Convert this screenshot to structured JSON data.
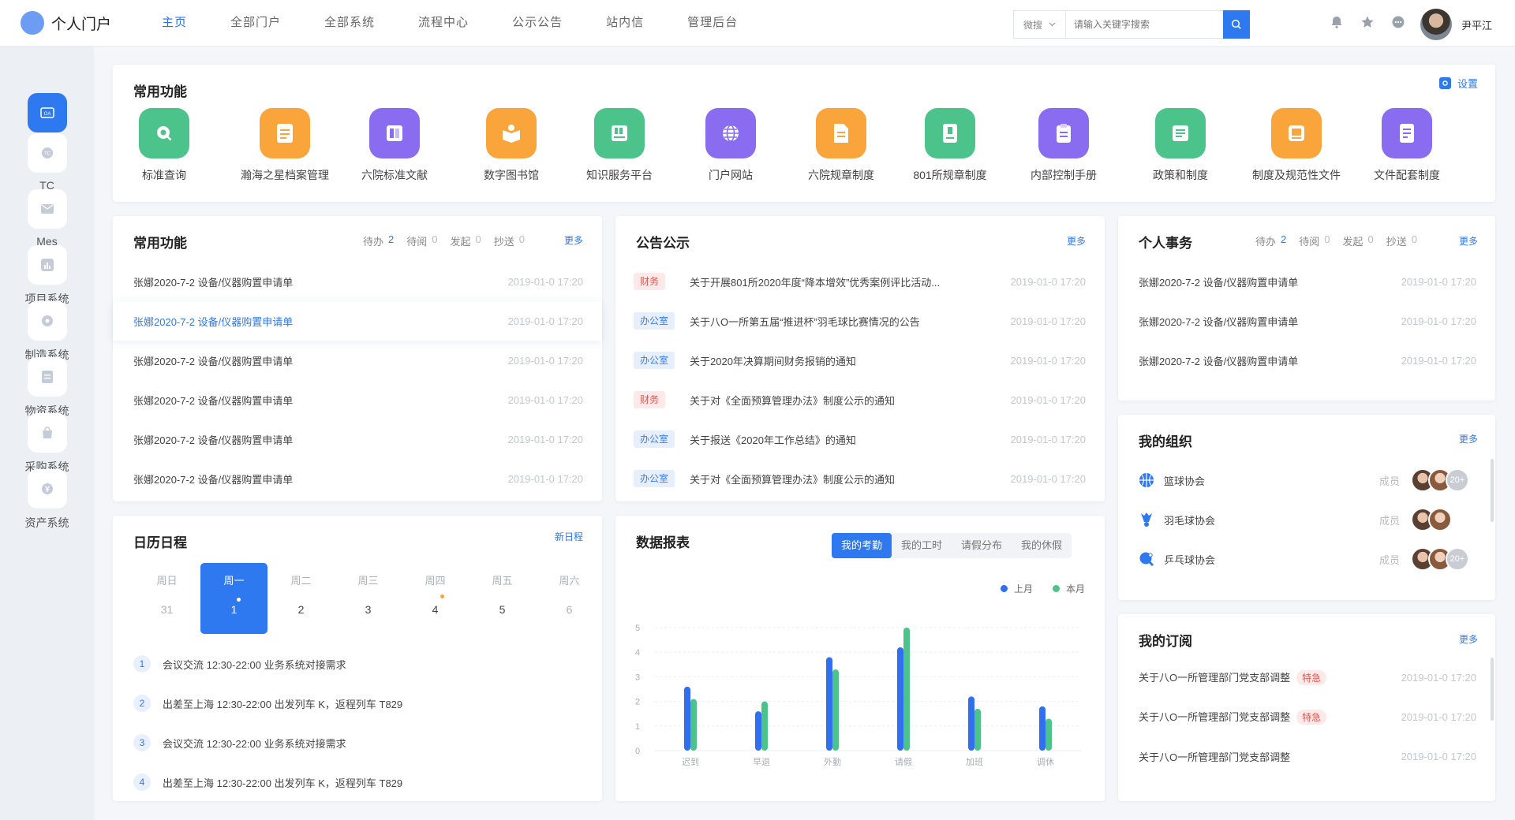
{
  "header": {
    "brand": "个人门户",
    "nav": [
      "主页",
      "全部门户",
      "全部系统",
      "流程中心",
      "公示公告",
      "站内信",
      "管理后台"
    ],
    "search": {
      "scope": "微搜",
      "placeholder": "请输入关键字搜索"
    },
    "user_name": "尹平江"
  },
  "sidebar": [
    "OA系统",
    "TC",
    "Mes",
    "项目系统",
    "制造系统",
    "物资系统",
    "采购系统",
    "资产系统"
  ],
  "quick": {
    "title": "常用功能",
    "settings": "设置",
    "tools": [
      "标准查询",
      "瀚海之星档案管理",
      "六院标准文献",
      "数字图书馆",
      "知识服务平台",
      "门户网站",
      "六院规章制度",
      "801所规章制度",
      "内部控制手册",
      "政策和制度",
      "制度及规范性文件",
      "文件配套制度"
    ]
  },
  "common": {
    "title": "常用功能",
    "stats": [
      {
        "label": "待办",
        "value": "2"
      },
      {
        "label": "待阅",
        "value": "0"
      },
      {
        "label": "发起",
        "value": "0"
      },
      {
        "label": "抄送",
        "value": "0"
      }
    ],
    "more": "更多",
    "rows": [
      {
        "text": "张娜2020-7-2 设备/仪器购置申请单",
        "time": "2019-01-0 17:20"
      },
      {
        "text": "张娜2020-7-2 设备/仪器购置申请单",
        "time": "2019-01-0 17:20"
      },
      {
        "text": "张娜2020-7-2 设备/仪器购置申请单",
        "time": "2019-01-0 17:20"
      },
      {
        "text": "张娜2020-7-2 设备/仪器购置申请单",
        "time": "2019-01-0 17:20"
      },
      {
        "text": "张娜2020-7-2 设备/仪器购置申请单",
        "time": "2019-01-0 17:20"
      },
      {
        "text": "张娜2020-7-2 设备/仪器购置申请单",
        "time": "2019-01-0 17:20"
      }
    ]
  },
  "notice": {
    "title": "公告公示",
    "more": "更多",
    "rows": [
      {
        "tag": "财务",
        "text": "关于开展801所2020年度“降本增效”优秀案例评比活动...",
        "time": "2019-01-0 17:20"
      },
      {
        "tag": "办公室",
        "text": "关于八O一所第五届“推进杯”羽毛球比赛情况的公告",
        "time": "2019-01-0 17:20"
      },
      {
        "tag": "办公室",
        "text": "关于2020年决算期间财务报销的通知",
        "time": "2019-01-0 17:20"
      },
      {
        "tag": "财务",
        "text": "关于对《全面预算管理办法》制度公示的通知",
        "time": "2019-01-0 17:20"
      },
      {
        "tag": "办公室",
        "text": "关于报送《2020年工作总结》的通知",
        "time": "2019-01-0 17:20"
      },
      {
        "tag": "办公室",
        "text": "关于对《全面预算管理办法》制度公示的通知",
        "time": "2019-01-0 17:20"
      }
    ]
  },
  "personal": {
    "title": "个人事务",
    "stats": [
      {
        "label": "待办",
        "value": "2"
      },
      {
        "label": "待阅",
        "value": "0"
      },
      {
        "label": "发起",
        "value": "0"
      },
      {
        "label": "抄送",
        "value": "0"
      }
    ],
    "more": "更多",
    "rows": [
      {
        "text": "张娜2020-7-2 设备/仪器购置申请单",
        "time": "2019-01-0 17:20"
      },
      {
        "text": "张娜2020-7-2 设备/仪器购置申请单",
        "time": "2019-01-0 17:20"
      },
      {
        "text": "张娜2020-7-2 设备/仪器购置申请单",
        "time": "2019-01-0 17:20"
      }
    ]
  },
  "calendar": {
    "title": "日历日程",
    "new": "新日程",
    "days": [
      {
        "name": "周日",
        "date": "31"
      },
      {
        "name": "周一",
        "date": "1"
      },
      {
        "name": "周二",
        "date": "2"
      },
      {
        "name": "周三",
        "date": "3"
      },
      {
        "name": "周四",
        "date": "4"
      },
      {
        "name": "周五",
        "date": "5"
      },
      {
        "name": "周六",
        "date": "6"
      }
    ],
    "items": [
      {
        "num": "1",
        "text": "会议交流  12:30-22:00 业务系统对接需求"
      },
      {
        "num": "2",
        "text": "出差至上海  12:30-22:00 出发列车 K，返程列车 T829"
      },
      {
        "num": "3",
        "text": "会议交流  12:30-22:00 业务系统对接需求"
      },
      {
        "num": "4",
        "text": "出差至上海  12:30-22:00 出发列车 K，返程列车 T829"
      }
    ]
  },
  "report": {
    "title": "数据报表",
    "tabs": [
      "我的考勤",
      "我的工时",
      "请假分布",
      "我的休假"
    ]
  },
  "chart_data": {
    "type": "bar",
    "categories": [
      "迟到",
      "早退",
      "外勤",
      "请假",
      "加班",
      "调休"
    ],
    "series": [
      {
        "name": "上月",
        "values": [
          2.6,
          1.6,
          3.8,
          4.2,
          2.2,
          1.8
        ],
        "color": "#2f6ff0"
      },
      {
        "name": "本月",
        "values": [
          2.1,
          2.0,
          3.3,
          5.0,
          1.7,
          1.3
        ],
        "color": "#4cc38a"
      }
    ],
    "ylim": [
      0,
      5
    ],
    "yticks": [
      "0",
      "1",
      "2",
      "3",
      "4",
      "5"
    ]
  },
  "org": {
    "title": "我的组织",
    "more": "更多",
    "member_label": "成员",
    "items": [
      {
        "name": "篮球协会",
        "more": "20+"
      },
      {
        "name": "羽毛球协会",
        "more": ""
      },
      {
        "name": "乒乓球协会",
        "more": "20+"
      }
    ]
  },
  "sub": {
    "title": "我的订阅",
    "more": "更多",
    "urgent": "特急",
    "rows": [
      {
        "text": "关于八O一所管理部门党支部调整",
        "time": "2019-01-0 17:20"
      },
      {
        "text": "关于八O一所管理部门党支部调整",
        "time": "2019-01-0 17:20"
      },
      {
        "text": "关于八O一所管理部门党支部调整",
        "time": "2019-01-0 17:20"
      }
    ]
  },
  "colors": {
    "primary": "#2f79f0",
    "green": "#4cc38a",
    "orange": "#f9a53c",
    "purple": "#8a6cf0",
    "red": "#e5574f"
  }
}
